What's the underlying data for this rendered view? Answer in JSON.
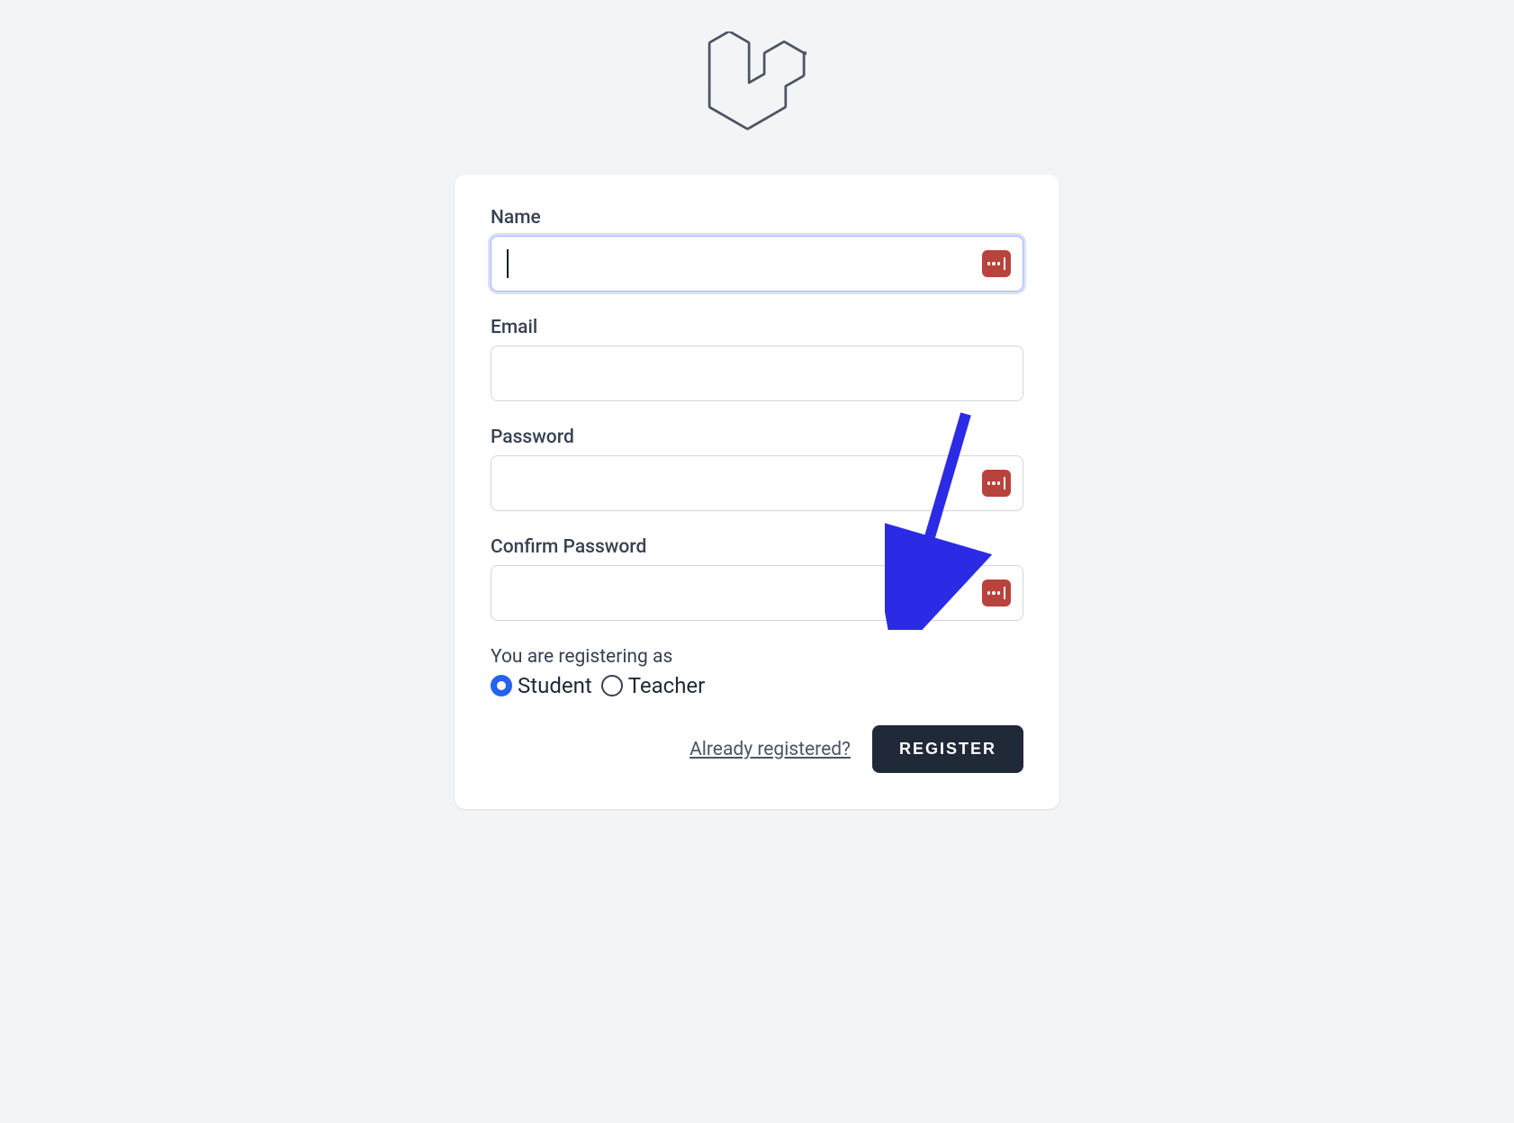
{
  "form": {
    "name_label": "Name",
    "name_value": "",
    "email_label": "Email",
    "email_value": "",
    "password_label": "Password",
    "password_value": "",
    "confirm_label": "Confirm Password",
    "confirm_value": "",
    "role_label": "You are registering as",
    "roles": {
      "student": "Student",
      "teacher": "Teacher",
      "selected": "student"
    },
    "already_link": "Already registered?",
    "register_button": "REGISTER"
  },
  "colors": {
    "accent": "#2563eb",
    "button_bg": "#1f2937",
    "badge_bg": "#b8433c",
    "focus_ring": "#c7d2fe"
  }
}
